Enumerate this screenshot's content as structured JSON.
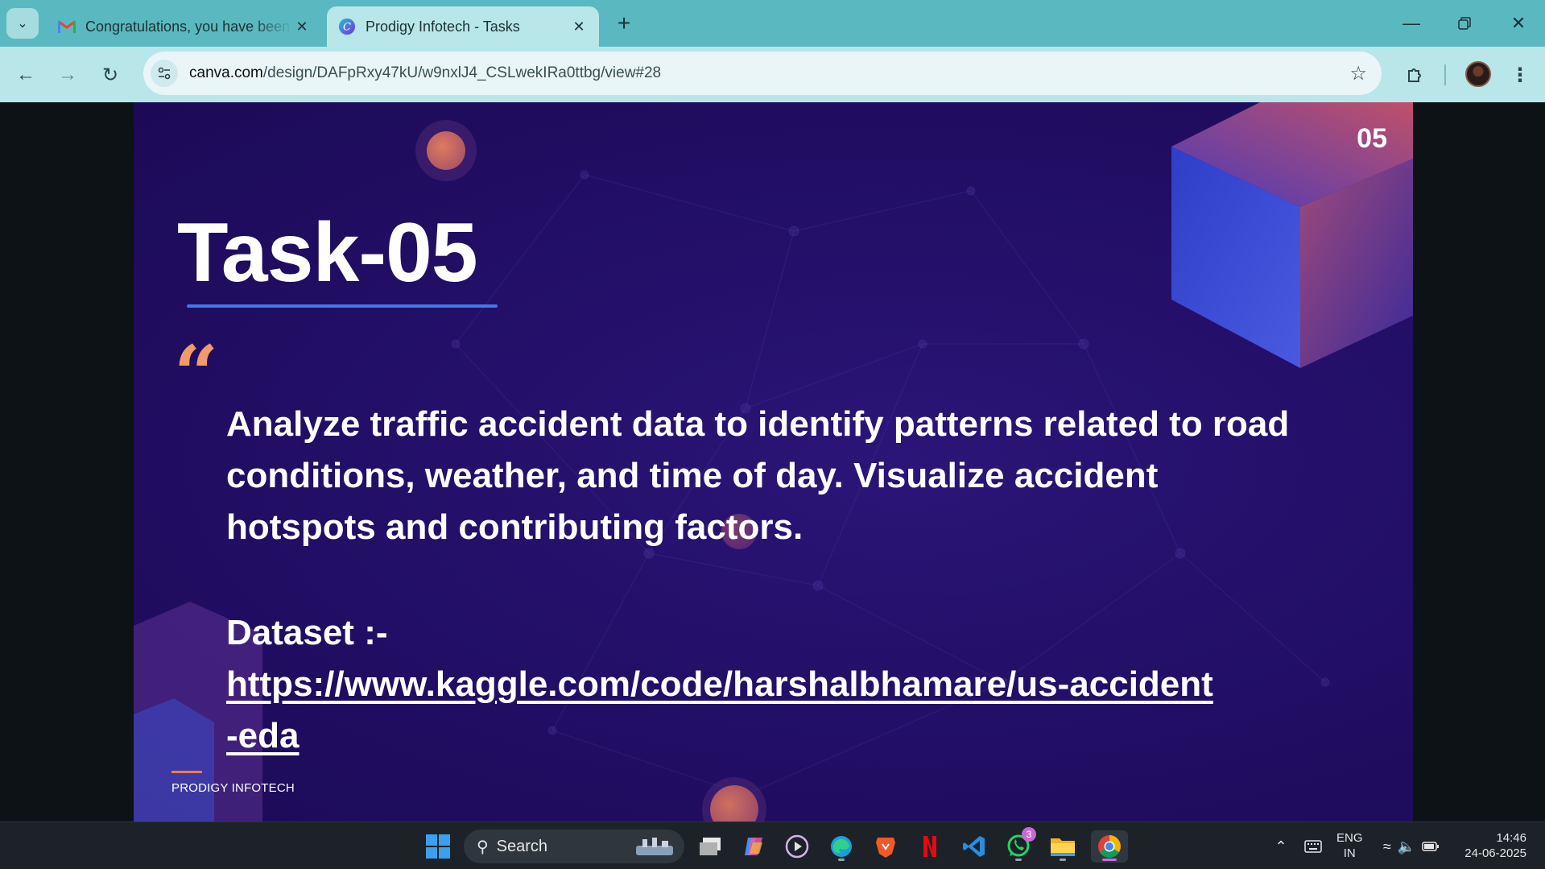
{
  "browser": {
    "tabs": [
      {
        "title": "Congratulations, you have been",
        "favicon": "gmail-icon",
        "active": false
      },
      {
        "title": "Prodigy Infotech - Tasks",
        "favicon": "canva-icon",
        "active": true
      }
    ],
    "url_host": "canva.com",
    "url_path": "/design/DAFpRxy47kU/w9nxlJ4_CSLwekIRa0ttbg/view#28"
  },
  "slide": {
    "number": "05",
    "title": "Task-05",
    "quote_mark": "“",
    "body": "Analyze traffic accident data to identify patterns related to road conditions, weather, and time of day. Visualize accident hotspots and contributing factors.",
    "dataset_label": "Dataset :-",
    "dataset_link": "https://www.kaggle.com/code/harshalbhamare/us-accident-eda",
    "footer": "PRODIGY INFOTECH",
    "colors": {
      "background": "#24106a",
      "accent_orange": "#f39a6a",
      "accent_blue": "#3f7be8"
    }
  },
  "taskbar": {
    "search_label": "Search",
    "whatsapp_badge": "3",
    "language_line1": "ENG",
    "language_line2": "IN",
    "time": "14:46",
    "date": "24-06-2025",
    "pinned": [
      "windows-start-icon",
      "task-view-icon",
      "copilot-icon",
      "media-player-icon",
      "edge-icon",
      "brave-icon",
      "netflix-icon",
      "vscode-icon",
      "whatsapp-icon",
      "file-explorer-icon",
      "chrome-icon"
    ]
  }
}
